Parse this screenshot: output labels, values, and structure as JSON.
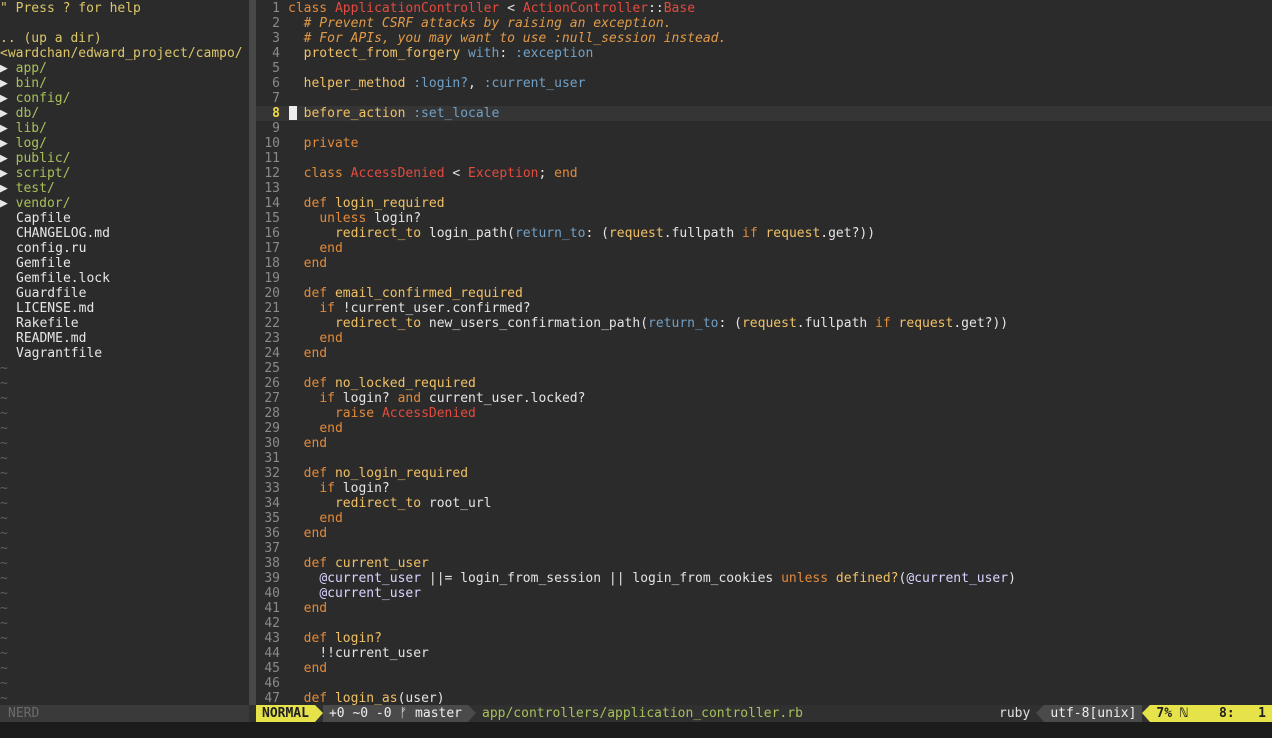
{
  "nerdtree": {
    "help": "\" Press ? for help",
    "up_dir": ".. (up a dir)",
    "root": "<wardchan/edward_project/campo/",
    "dirs": [
      "app",
      "bin",
      "config",
      "db",
      "lib",
      "log",
      "public",
      "script",
      "test",
      "vendor"
    ],
    "files": [
      "Capfile",
      "CHANGELOG.md",
      "config.ru",
      "Gemfile",
      "Gemfile.lock",
      "Guardfile",
      "LICENSE.md",
      "Rakefile",
      "README.md",
      "Vagrantfile"
    ],
    "empty_marker": "~",
    "status": "NERD"
  },
  "editor": {
    "current_line": 8,
    "lines": [
      [
        [
          "kw",
          "class "
        ],
        [
          "const",
          "ApplicationController"
        ],
        [
          "op",
          " < "
        ],
        [
          "const",
          "ActionController"
        ],
        [
          "op",
          "::"
        ],
        [
          "const",
          "Base"
        ]
      ],
      [
        [
          "",
          "  "
        ],
        [
          "cm",
          "# Prevent CSRF attacks by raising an exception."
        ]
      ],
      [
        [
          "",
          "  "
        ],
        [
          "cm",
          "# For APIs, you may want to use :null_session instead."
        ]
      ],
      [
        [
          "",
          "  "
        ],
        [
          "fn",
          "protect_from_forgery "
        ],
        [
          "sym",
          "with"
        ],
        [
          "op",
          ": "
        ],
        [
          "sym",
          ":exception"
        ]
      ],
      [],
      [
        [
          "",
          "  "
        ],
        [
          "fn",
          "helper_method "
        ],
        [
          "sym",
          ":login?"
        ],
        [
          "op",
          ", "
        ],
        [
          "sym",
          ":current_user"
        ]
      ],
      [],
      [
        [
          "",
          "  "
        ],
        [
          "fn",
          "before_action "
        ],
        [
          "sym",
          ":set_locale"
        ]
      ],
      [],
      [
        [
          "",
          "  "
        ],
        [
          "kw",
          "private"
        ]
      ],
      [],
      [
        [
          "",
          "  "
        ],
        [
          "kw",
          "class "
        ],
        [
          "const",
          "AccessDenied"
        ],
        [
          "op",
          " < "
        ],
        [
          "const",
          "Exception"
        ],
        [
          "op",
          "; "
        ],
        [
          "kw",
          "end"
        ]
      ],
      [],
      [
        [
          "",
          "  "
        ],
        [
          "kw",
          "def "
        ],
        [
          "fn",
          "login_required"
        ]
      ],
      [
        [
          "",
          "    "
        ],
        [
          "kw",
          "unless "
        ],
        [
          "",
          "login?"
        ]
      ],
      [
        [
          "",
          "      "
        ],
        [
          "fn",
          "redirect_to "
        ],
        [
          "",
          "login_path("
        ],
        [
          "sym",
          "return_to"
        ],
        [
          "",
          ": ("
        ],
        [
          "fn",
          "request"
        ],
        [
          "",
          ".fullpath "
        ],
        [
          "kw",
          "if "
        ],
        [
          "fn",
          "request"
        ],
        [
          "",
          ".get?))"
        ]
      ],
      [
        [
          "",
          "    "
        ],
        [
          "kw",
          "end"
        ]
      ],
      [
        [
          "",
          "  "
        ],
        [
          "kw",
          "end"
        ]
      ],
      [],
      [
        [
          "",
          "  "
        ],
        [
          "kw",
          "def "
        ],
        [
          "fn",
          "email_confirmed_required"
        ]
      ],
      [
        [
          "",
          "    "
        ],
        [
          "kw",
          "if "
        ],
        [
          "",
          "!current_user.confirmed?"
        ]
      ],
      [
        [
          "",
          "      "
        ],
        [
          "fn",
          "redirect_to "
        ],
        [
          "",
          "new_users_confirmation_path("
        ],
        [
          "sym",
          "return_to"
        ],
        [
          "",
          ": ("
        ],
        [
          "fn",
          "request"
        ],
        [
          "",
          ".fullpath "
        ],
        [
          "kw",
          "if "
        ],
        [
          "fn",
          "request"
        ],
        [
          "",
          ".get?))"
        ]
      ],
      [
        [
          "",
          "    "
        ],
        [
          "kw",
          "end"
        ]
      ],
      [
        [
          "",
          "  "
        ],
        [
          "kw",
          "end"
        ]
      ],
      [],
      [
        [
          "",
          "  "
        ],
        [
          "kw",
          "def "
        ],
        [
          "fn",
          "no_locked_required"
        ]
      ],
      [
        [
          "",
          "    "
        ],
        [
          "kw",
          "if "
        ],
        [
          "",
          "login? "
        ],
        [
          "kw",
          "and "
        ],
        [
          "",
          "current_user.locked?"
        ]
      ],
      [
        [
          "",
          "      "
        ],
        [
          "kw",
          "raise "
        ],
        [
          "const",
          "AccessDenied"
        ]
      ],
      [
        [
          "",
          "    "
        ],
        [
          "kw",
          "end"
        ]
      ],
      [
        [
          "",
          "  "
        ],
        [
          "kw",
          "end"
        ]
      ],
      [],
      [
        [
          "",
          "  "
        ],
        [
          "kw",
          "def "
        ],
        [
          "fn",
          "no_login_required"
        ]
      ],
      [
        [
          "",
          "    "
        ],
        [
          "kw",
          "if "
        ],
        [
          "",
          "login?"
        ]
      ],
      [
        [
          "",
          "      "
        ],
        [
          "fn",
          "redirect_to "
        ],
        [
          "",
          "root_url"
        ]
      ],
      [
        [
          "",
          "    "
        ],
        [
          "kw",
          "end"
        ]
      ],
      [
        [
          "",
          "  "
        ],
        [
          "kw",
          "end"
        ]
      ],
      [],
      [
        [
          "",
          "  "
        ],
        [
          "kw",
          "def "
        ],
        [
          "fn",
          "current_user"
        ]
      ],
      [
        [
          "",
          "    "
        ],
        [
          "ivar",
          "@current_user "
        ],
        [
          "",
          "||= login_from_session || login_from_cookies "
        ],
        [
          "kw",
          "unless "
        ],
        [
          "fn",
          "defined?"
        ],
        [
          "",
          "("
        ],
        [
          "ivar",
          "@current_user"
        ],
        [
          "",
          ")"
        ]
      ],
      [
        [
          "",
          "    "
        ],
        [
          "ivar",
          "@current_user"
        ]
      ],
      [
        [
          "",
          "  "
        ],
        [
          "kw",
          "end"
        ]
      ],
      [],
      [
        [
          "",
          "  "
        ],
        [
          "kw",
          "def "
        ],
        [
          "fn",
          "login?"
        ]
      ],
      [
        [
          "",
          "    "
        ],
        [
          "",
          "!!current_user"
        ]
      ],
      [
        [
          "",
          "  "
        ],
        [
          "kw",
          "end"
        ]
      ],
      [],
      [
        [
          "",
          "  "
        ],
        [
          "kw",
          "def "
        ],
        [
          "fn",
          "login_as"
        ],
        [
          "",
          "(user)"
        ]
      ]
    ]
  },
  "statusline": {
    "mode": "NORMAL",
    "git": "+0 ~0 -0 ᚠ master",
    "filepath": "app/controllers/application_controller.rb",
    "filetype": "ruby",
    "encoding": "utf-8[unix]",
    "position": "7% ℕ    8:   1"
  },
  "colors": {
    "background": "#2b2b2b",
    "mode_bg": "#e5e24a",
    "keyword": "#e38a3a",
    "constant": "#e24b3e",
    "symbol": "#71a0c6",
    "directory": "#a6c05a"
  }
}
